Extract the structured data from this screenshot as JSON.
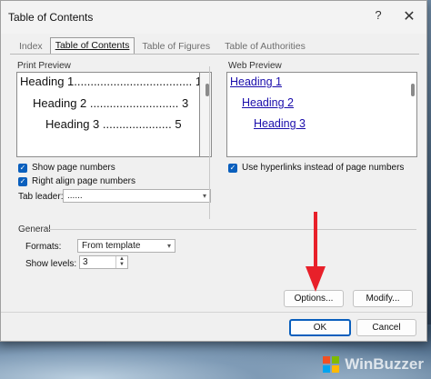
{
  "dialog": {
    "title": "Table of Contents",
    "help_glyph": "?",
    "close_glyph": "✕"
  },
  "tabs": [
    {
      "label": "Index",
      "active": false
    },
    {
      "label": "Table of Contents",
      "active": true
    },
    {
      "label": "Table of Figures",
      "active": false
    },
    {
      "label": "Table of Authorities",
      "active": false
    }
  ],
  "print_preview": {
    "label": "Print Preview",
    "lines": [
      {
        "text": "Heading 1.................................... 1"
      },
      {
        "text": "Heading 2 ........................... 3"
      },
      {
        "text": "Heading 3 ..................... 5"
      }
    ]
  },
  "web_preview": {
    "label": "Web Preview",
    "links": [
      "Heading 1",
      "Heading 2",
      "Heading 3"
    ]
  },
  "options": {
    "show_page_numbers": {
      "label": "Show page numbers",
      "checked": true
    },
    "right_align": {
      "label": "Right align page numbers",
      "checked": true
    },
    "use_hyperlinks": {
      "label": "Use hyperlinks instead of page numbers",
      "checked": true
    },
    "tab_leader": {
      "label": "Tab leader:",
      "value": "......"
    }
  },
  "general": {
    "label": "General",
    "formats_label": "Formats:",
    "formats_value": "From template",
    "levels_label": "Show levels:",
    "levels_value": "3"
  },
  "buttons": {
    "options": "Options...",
    "modify": "Modify...",
    "ok": "OK",
    "cancel": "Cancel"
  },
  "colors": {
    "accent": "#0a5fbd",
    "link": "#1a0dab",
    "arrow": "#e8202a"
  },
  "watermark": {
    "text": "WinBuzzer"
  }
}
